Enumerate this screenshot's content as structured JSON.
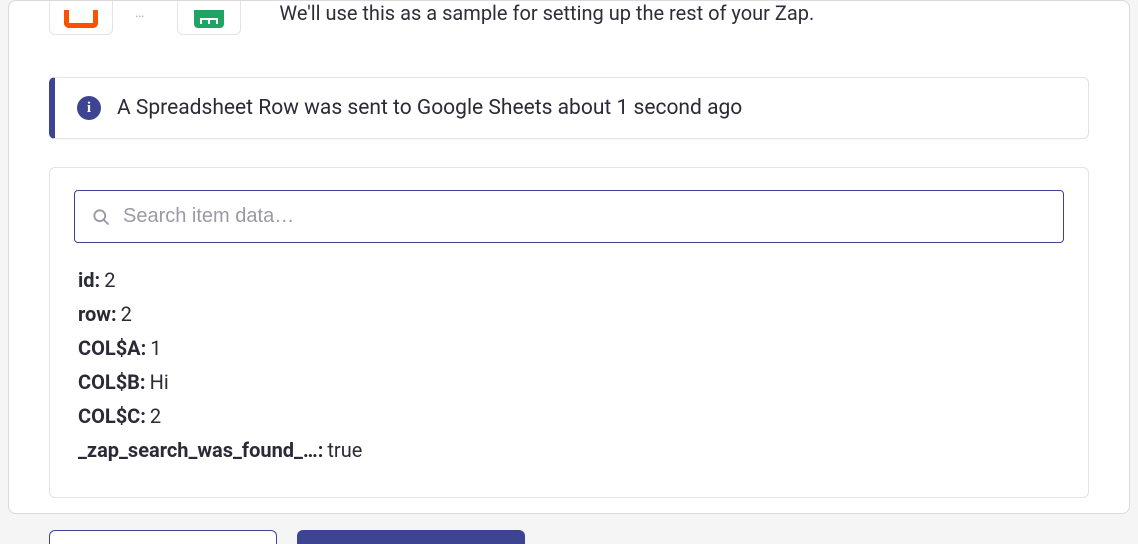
{
  "hint": "We'll use this as a sample for setting up the rest of your Zap.",
  "alert": {
    "icon_glyph": "i",
    "text": "A Spreadsheet Row was sent to Google Sheets about 1 second ago"
  },
  "search": {
    "placeholder": "Search item data…",
    "value": ""
  },
  "fields": [
    {
      "key": "id:",
      "value": "2"
    },
    {
      "key": "row:",
      "value": "2"
    },
    {
      "key": "COL$A:",
      "value": "1"
    },
    {
      "key": "COL$B:",
      "value": "Hi"
    },
    {
      "key": "COL$C:",
      "value": "2"
    },
    {
      "key": "_zap_search_was_found_…:",
      "value": "true"
    }
  ],
  "dots": "…"
}
